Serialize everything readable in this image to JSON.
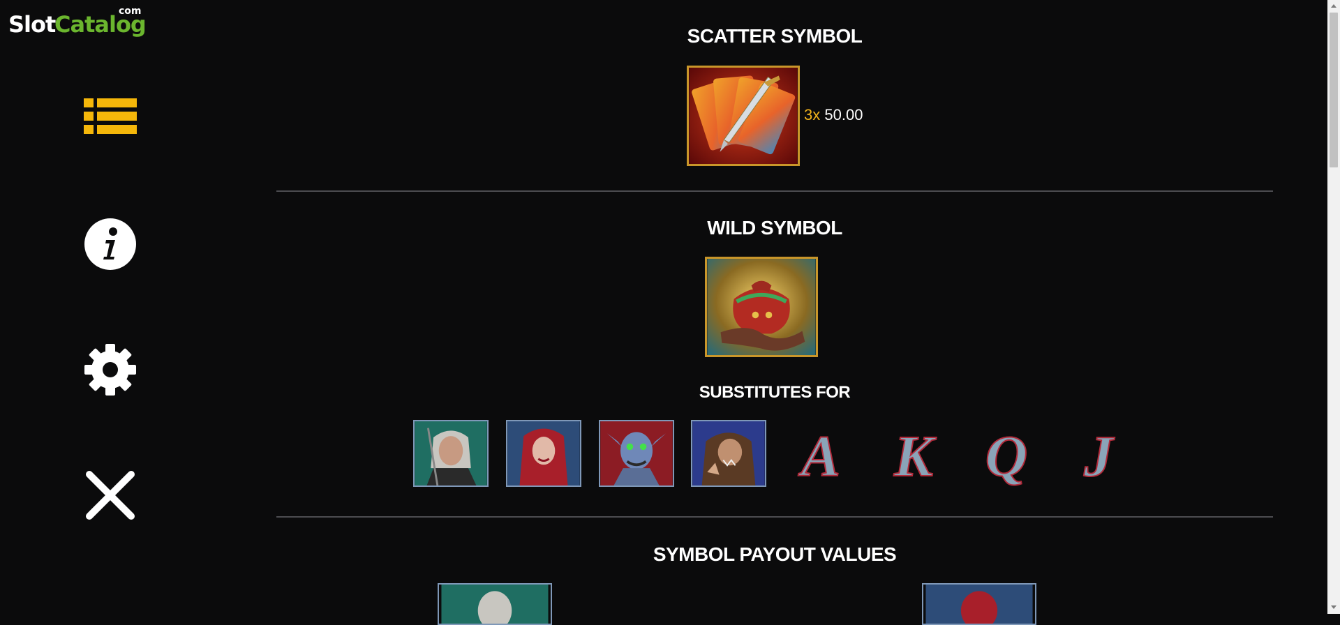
{
  "logo": {
    "part1": "Slot",
    "part2": "Catalog",
    "suffix": "com"
  },
  "sidebar": {
    "items": [
      {
        "icon": "list-icon",
        "color": "#f5b70a"
      },
      {
        "icon": "info-icon",
        "color": "#ffffff"
      },
      {
        "icon": "gear-icon",
        "color": "#ffffff"
      },
      {
        "icon": "close-icon",
        "color": "#ffffff"
      }
    ]
  },
  "scatter": {
    "title": "SCATTER SYMBOL",
    "symbol_icon": "scatter-cards-dagger-icon",
    "payout": {
      "multiplier": "3x",
      "value": "50.00"
    }
  },
  "wild": {
    "title": "WILD SYMBOL",
    "symbol_icon": "wild-pouch-icon",
    "substitutes_title": "SUBSTITUTES FOR",
    "substitutes": [
      {
        "icon": "hunter-portrait-icon"
      },
      {
        "icon": "vampire-woman-portrait-icon"
      },
      {
        "icon": "ghoul-portrait-icon"
      },
      {
        "icon": "werewolf-portrait-icon"
      },
      {
        "letter": "A"
      },
      {
        "letter": "K"
      },
      {
        "letter": "Q"
      },
      {
        "letter": "J"
      }
    ]
  },
  "payouts": {
    "title": "SYMBOL PAYOUT VALUES"
  },
  "colors": {
    "accent_gold": "#f2b31c",
    "brand_green": "#6bb62e",
    "frame_gold": "#c9962a"
  }
}
